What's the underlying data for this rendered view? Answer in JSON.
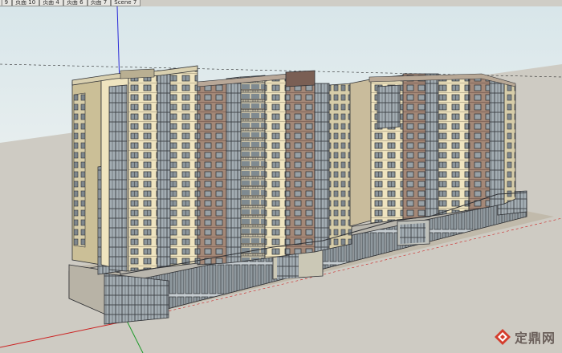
{
  "scene_tabs": [
    {
      "label": "| 9"
    },
    {
      "label": "页面 10"
    },
    {
      "label": "页面 4"
    },
    {
      "label": "页面 6"
    },
    {
      "label": "页面 7"
    },
    {
      "label": "Scene 7"
    }
  ],
  "watermark": {
    "text": "定鼎网",
    "logo": "dingding-logo-icon"
  },
  "colors": {
    "sky": "#dde8ea",
    "ground": "#cdcbc3",
    "cream": "#efe4bf",
    "brown": "#a48877",
    "dark_brown": "#7a5f54",
    "glass": "#9aa6ae",
    "mullion": "#3e4146",
    "shadow": "#b9ad98",
    "red_axis": "#cc2020",
    "blue_axis": "#2a2ad8",
    "green_axis": "#1e9a2a"
  }
}
